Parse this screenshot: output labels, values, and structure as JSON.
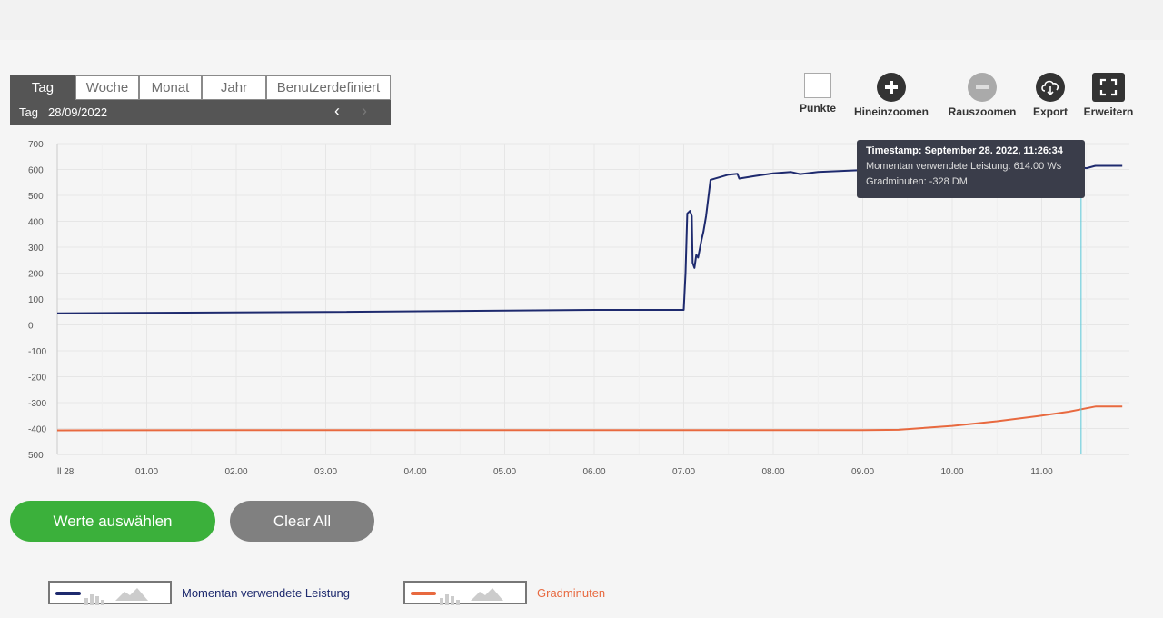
{
  "period_selector": {
    "tabs": [
      "Tag",
      "Woche",
      "Monat",
      "Jahr",
      "Benutzerdefiniert"
    ],
    "active_tab": "Tag",
    "date_label": "Tag",
    "date_value": "28/09/2022",
    "prev_icon": "chevron-left-icon",
    "next_icon": "chevron-right-icon"
  },
  "toolbar": {
    "points_label": "Punkte",
    "zoom_in_label": "Hineinzoomen",
    "zoom_out_label": "Rauszoomen",
    "export_label": "Export",
    "expand_label": "Erweitern"
  },
  "tooltip": {
    "timestamp": "Timestamp: September 28. 2022, 11:26:34",
    "line1": "Momentan verwendete Leistung: 614.00 Ws",
    "line2": "Gradminuten: -328 DM"
  },
  "buttons": {
    "select_values": "Werte auswählen",
    "clear_all": "Clear All"
  },
  "legend": {
    "series1": "Momentan verwendete Leistung",
    "series2": "Gradminuten"
  },
  "colors": {
    "series1": "#1e2a6e",
    "series2": "#e8693f",
    "crosshair": "#5bc8d8",
    "green_button": "#3bb03b",
    "grey_button": "#808080"
  },
  "chart_data": {
    "type": "line",
    "ylim": [
      -500,
      700
    ],
    "xlim": [
      0,
      11.9
    ],
    "y_ticks": [
      "700",
      "600",
      "500",
      "400",
      "300",
      "200",
      "100",
      "0",
      "-100",
      "-200",
      "-300",
      "-400",
      "500"
    ],
    "x_ticks": [
      "ll 28",
      "01.00",
      "02.00",
      "03.00",
      "04.00",
      "05.00",
      "06.00",
      "07.00",
      "08.00",
      "09.00",
      "10.00",
      "11.00"
    ],
    "crosshair_x": 11.44,
    "series": [
      {
        "name": "Momentan verwendete Leistung",
        "points": [
          [
            0,
            45
          ],
          [
            3,
            50
          ],
          [
            6,
            58
          ],
          [
            7.0,
            58
          ],
          [
            7.02,
            200
          ],
          [
            7.04,
            430
          ],
          [
            7.07,
            440
          ],
          [
            7.09,
            420
          ],
          [
            7.1,
            240
          ],
          [
            7.12,
            220
          ],
          [
            7.14,
            270
          ],
          [
            7.16,
            260
          ],
          [
            7.2,
            330
          ],
          [
            7.22,
            360
          ],
          [
            7.25,
            420
          ],
          [
            7.3,
            560
          ],
          [
            7.5,
            580
          ],
          [
            7.6,
            583
          ],
          [
            7.62,
            565
          ],
          [
            7.8,
            575
          ],
          [
            8.0,
            585
          ],
          [
            8.2,
            590
          ],
          [
            8.3,
            582
          ],
          [
            8.5,
            590
          ],
          [
            9.0,
            598
          ],
          [
            9.5,
            605
          ],
          [
            10.0,
            610
          ],
          [
            10.5,
            612
          ],
          [
            11.0,
            612
          ],
          [
            11.35,
            612
          ],
          [
            11.5,
            605
          ],
          [
            11.6,
            614
          ],
          [
            11.9,
            614
          ]
        ]
      },
      {
        "name": "Gradminuten",
        "points": [
          [
            0,
            -407
          ],
          [
            3,
            -406
          ],
          [
            6,
            -406
          ],
          [
            9.0,
            -406
          ],
          [
            9.4,
            -405
          ],
          [
            10.0,
            -390
          ],
          [
            10.5,
            -372
          ],
          [
            11.0,
            -350
          ],
          [
            11.3,
            -335
          ],
          [
            11.6,
            -315
          ],
          [
            11.9,
            -315
          ]
        ]
      }
    ]
  }
}
